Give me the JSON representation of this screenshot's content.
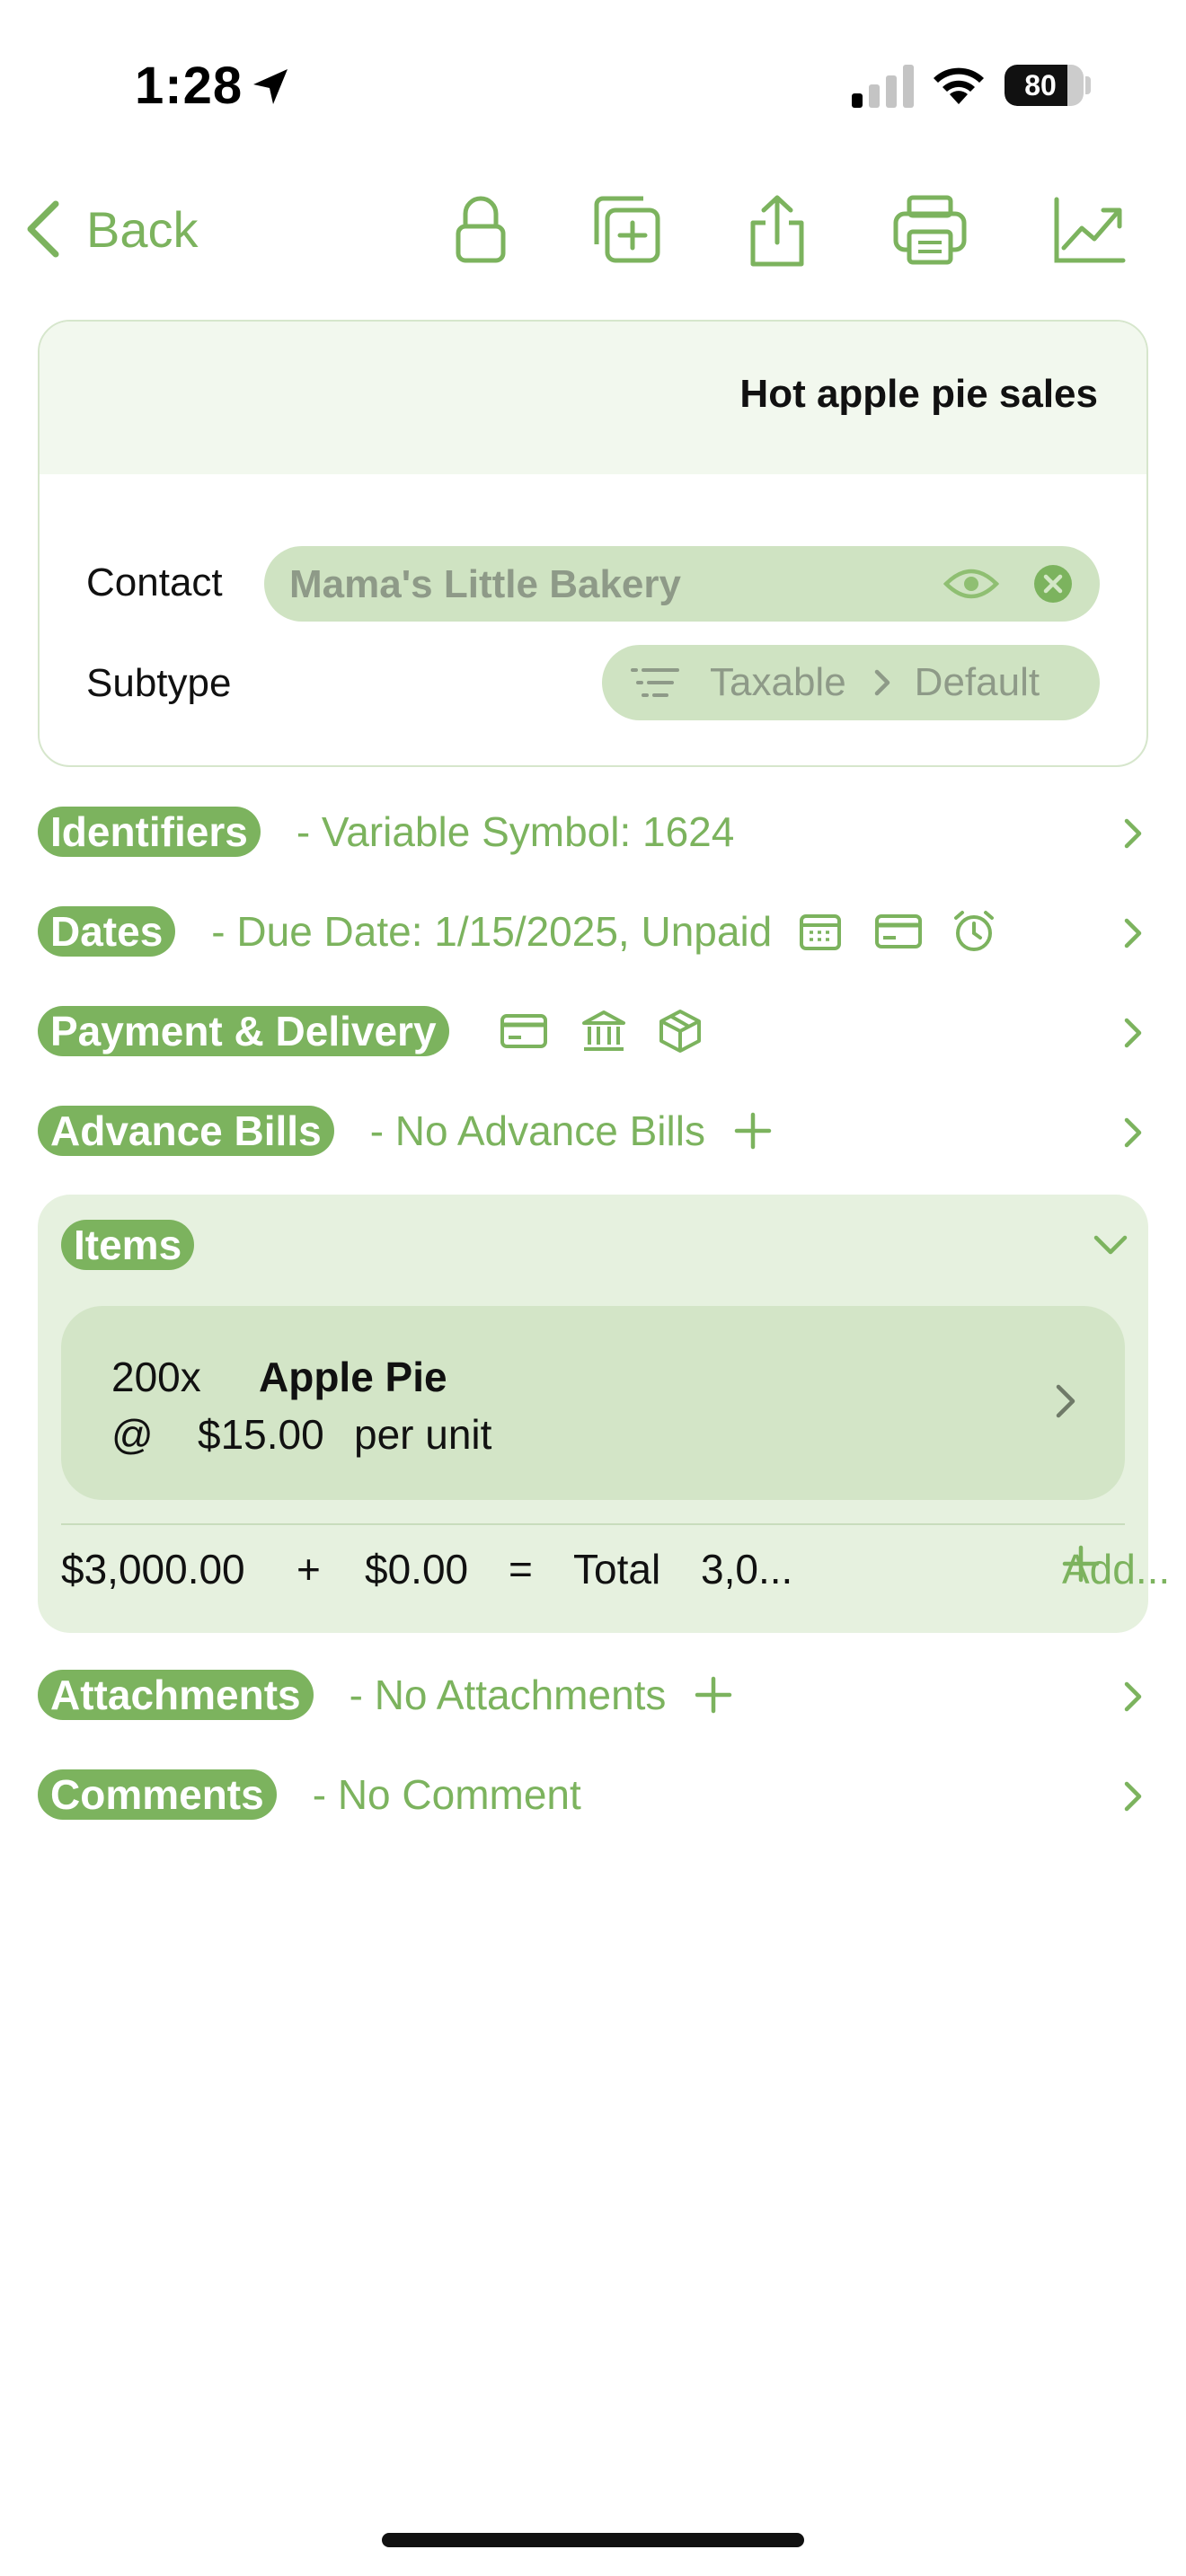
{
  "status_bar": {
    "time": "1:28",
    "battery_level": 80,
    "battery_label": "80"
  },
  "nav": {
    "back_label": "Back"
  },
  "header": {
    "title": "Hot apple pie sales",
    "contact_label": "Contact",
    "contact_value": "Mama's Little Bakery",
    "subtype_label": "Subtype",
    "subtype_value": "Taxable",
    "subtype_detail": "Default"
  },
  "sections": {
    "identifiers": {
      "label": "Identifiers",
      "summary": "- Variable Symbol: 1624"
    },
    "dates": {
      "label": "Dates",
      "summary": "- Due Date: 1/15/2025, Unpaid"
    },
    "payment": {
      "label": "Payment & Delivery"
    },
    "advance": {
      "label": "Advance Bills",
      "summary": "- No Advance Bills"
    },
    "attachments": {
      "label": "Attachments",
      "summary": "- No Attachments"
    },
    "comments": {
      "label": "Comments",
      "summary": "- No Comment"
    }
  },
  "items": {
    "label": "Items",
    "list": [
      {
        "qty": "200x",
        "name": "Apple Pie",
        "at": "@",
        "price": "$15.00",
        "unit": "per unit"
      }
    ],
    "subtotal": "$3,000.00",
    "plus": "+",
    "tax": "$0.00",
    "equals": "=",
    "total_label": "Total",
    "total_value": "3,0...",
    "add_label": "Add..."
  },
  "colors": {
    "accent": "#7cb35e",
    "field_bg": "#cfe3c2",
    "items_bg": "#e6f1df"
  }
}
